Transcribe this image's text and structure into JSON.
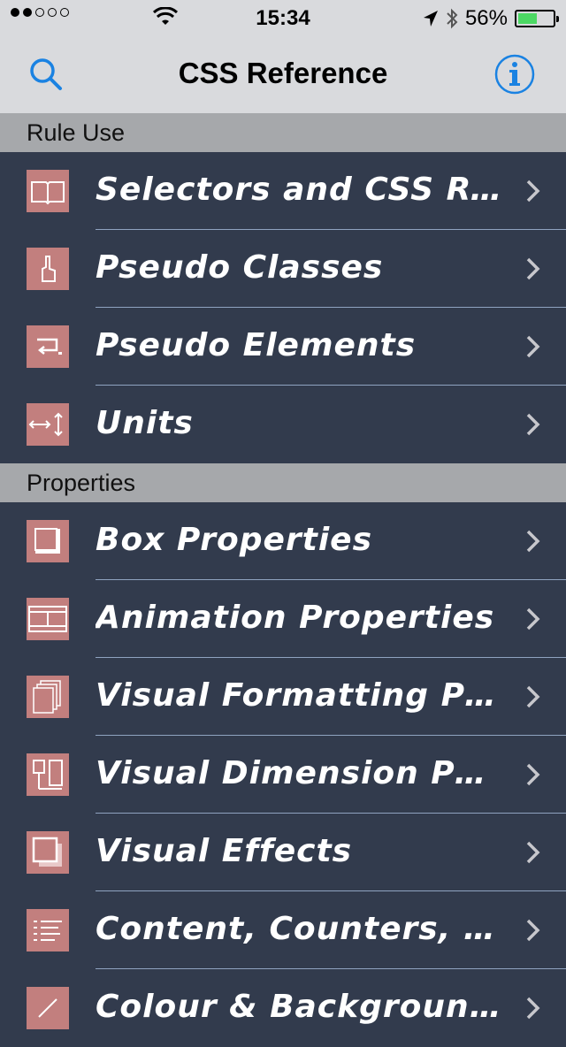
{
  "status_bar": {
    "time": "15:34",
    "battery": "56%",
    "battery_level": 0.56,
    "signal_dots_filled": 2,
    "signal_dots_total": 5
  },
  "nav": {
    "title": "CSS Reference"
  },
  "sections": [
    {
      "title": "Rule Use",
      "items": [
        {
          "label": "Selectors and CSS Rules",
          "icon": "book-icon"
        },
        {
          "label": "Pseudo Classes",
          "icon": "hand-pointer-icon"
        },
        {
          "label": "Pseudo Elements",
          "icon": "return-arrow-icon"
        },
        {
          "label": "Units",
          "icon": "arrows-icon"
        }
      ]
    },
    {
      "title": "Properties",
      "items": [
        {
          "label": "Box Properties",
          "icon": "box-icon"
        },
        {
          "label": "Animation Properties",
          "icon": "film-icon"
        },
        {
          "label": "Visual Formatting Propert...",
          "icon": "stacked-pages-icon"
        },
        {
          "label": "Visual Dimension Properties",
          "icon": "dimension-icon"
        },
        {
          "label": "Visual Effects",
          "icon": "shadow-box-icon"
        },
        {
          "label": "Content, Counters, Lists",
          "icon": "list-icon"
        },
        {
          "label": "Colour & Background Prope",
          "icon": "pen-icon"
        }
      ]
    }
  ],
  "colors": {
    "accent": "#1a82e2",
    "row_background": "#323b4d",
    "icon_background": "#c27f7e",
    "section_header": "#a6a8ab",
    "separator": "#8fa3c0"
  }
}
